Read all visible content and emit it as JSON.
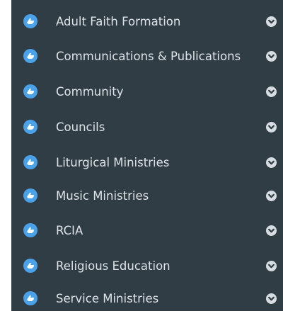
{
  "menu": {
    "icon": "praying-hands-icon",
    "chevron_icon": "chevron-down-icon",
    "colors": {
      "background": "#313d45",
      "icon": "#4aa3ea",
      "text": "#dde3e8",
      "chevron": "#d7dde2"
    },
    "items": [
      {
        "label": "Adult Faith Formation"
      },
      {
        "label": "Communications & Publications"
      },
      {
        "label": "Community"
      },
      {
        "label": "Councils"
      },
      {
        "label": "Liturgical Ministries"
      },
      {
        "label": "Music Ministries"
      },
      {
        "label": "RCIA"
      },
      {
        "label": "Religious Education"
      },
      {
        "label": "Service Ministries"
      }
    ]
  }
}
